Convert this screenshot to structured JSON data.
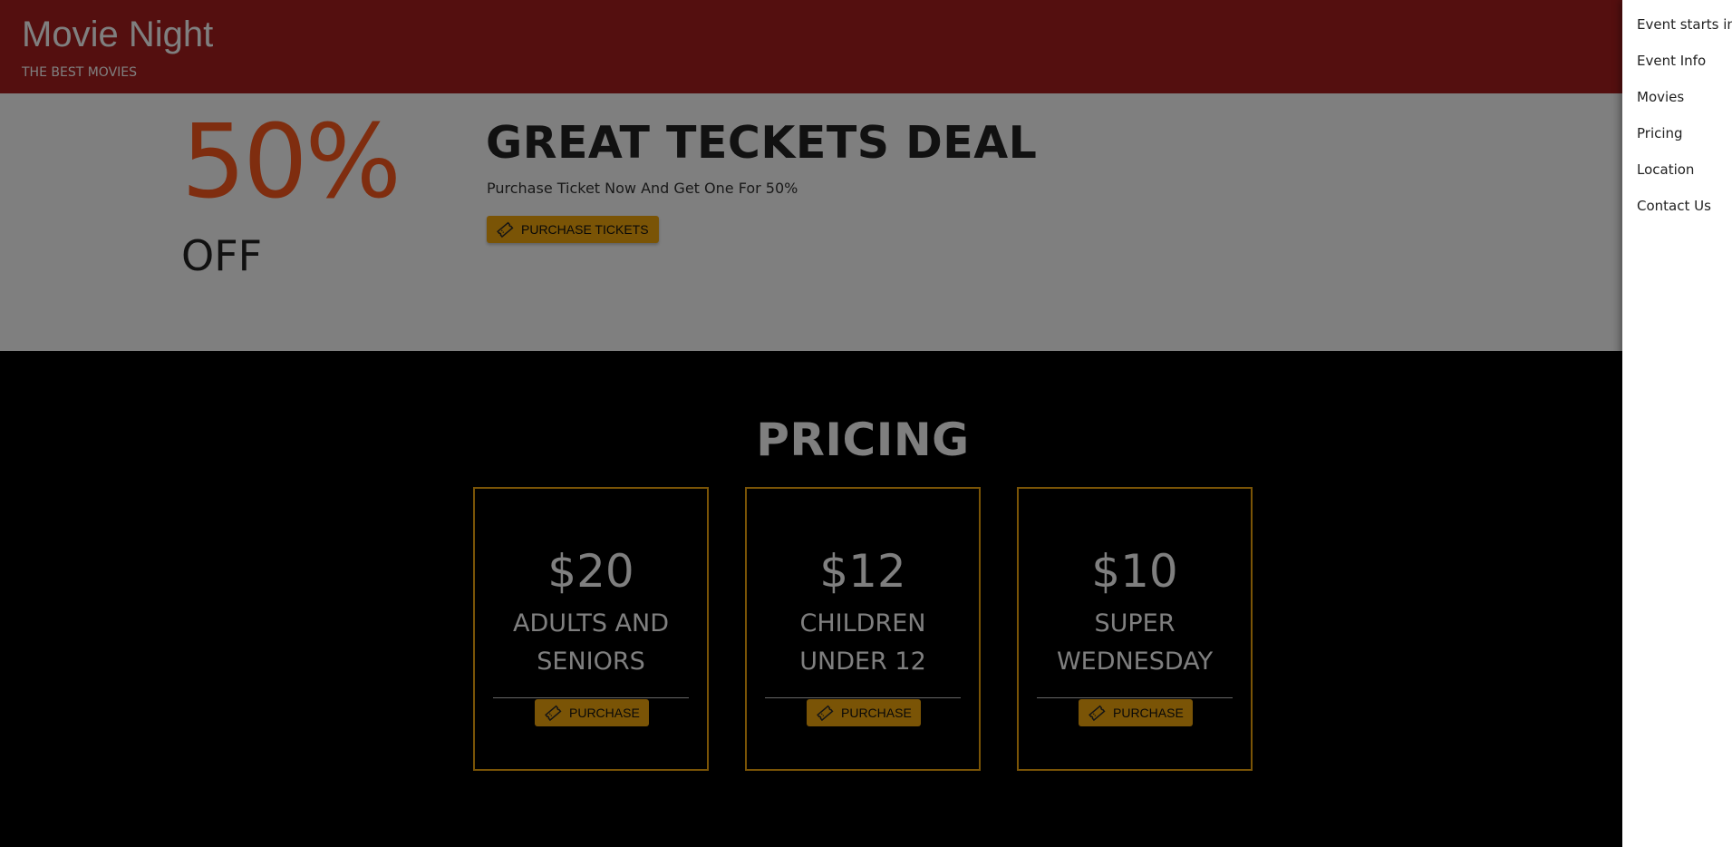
{
  "header": {
    "title": "Movie Night",
    "subtitle": "THE BEST MOVIES"
  },
  "deal": {
    "percent": "50%",
    "off": "OFF",
    "title": "GREAT TECKETS DEAL",
    "description": "Purchase Ticket Now And Get One For 50%",
    "button_label": "PURCHASE TICKETS",
    "button_icon": "ticket-icon"
  },
  "pricing": {
    "title": "PRICING",
    "cards": [
      {
        "price": "$20",
        "label": "ADULTS AND SENIORS",
        "button_label": "PURCHASE"
      },
      {
        "price": "$12",
        "label": "CHILDREN UNDER 12",
        "button_label": "PURCHASE"
      },
      {
        "price": "$10",
        "label": "SUPER WEDNESDAY",
        "button_label": "PURCHASE"
      }
    ]
  },
  "sidenav": {
    "items": [
      {
        "label": "Event starts in"
      },
      {
        "label": "Event Info"
      },
      {
        "label": "Movies"
      },
      {
        "label": "Pricing"
      },
      {
        "label": "Location"
      },
      {
        "label": "Contact Us"
      }
    ]
  },
  "colors": {
    "header_bg": "#a81f1f",
    "accent_orange": "#ff5a1f",
    "button_gold": "#f5a80d",
    "overlay": "rgba(0,0,0,0.5)"
  }
}
